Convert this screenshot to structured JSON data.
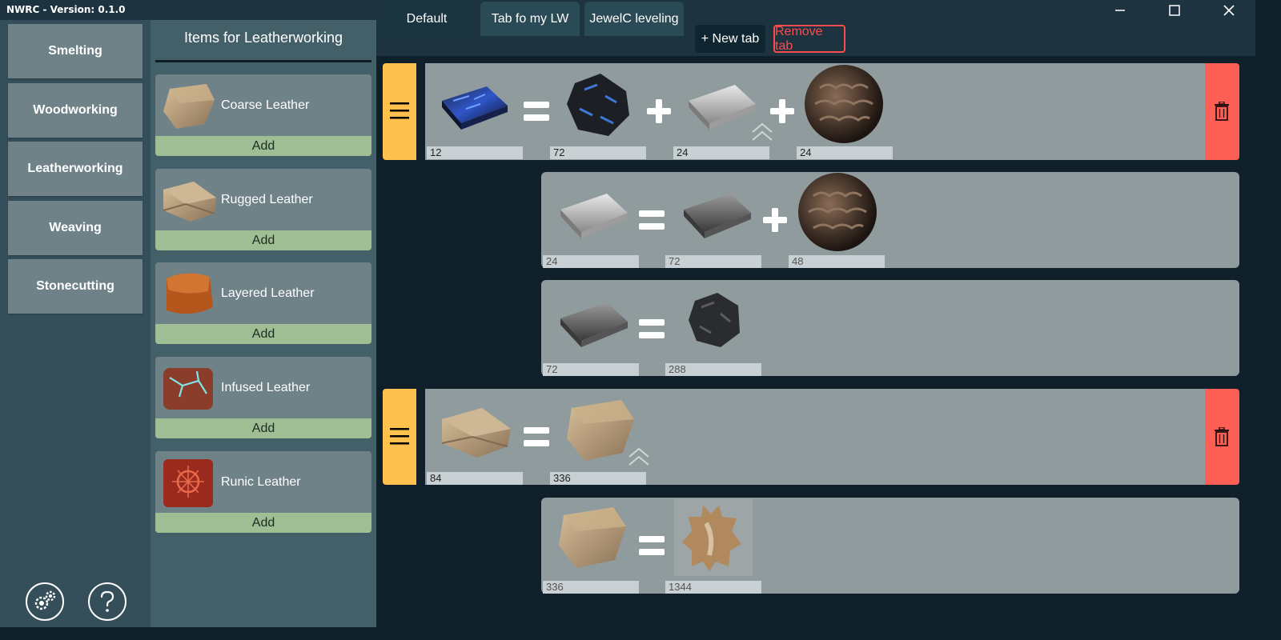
{
  "window": {
    "title": "NWRC - Version: 0.1.0"
  },
  "nav": {
    "items": [
      "Smelting",
      "Woodworking",
      "Leatherworking",
      "Weaving",
      "Stonecutting"
    ],
    "settings_icon": "gears-icon",
    "help_icon": "question-icon"
  },
  "items_panel": {
    "title": "Items for Leatherworking",
    "add_label": "Add",
    "items": [
      {
        "name": "Coarse Leather",
        "icon": "coarse-leather-icon"
      },
      {
        "name": "Rugged Leather",
        "icon": "rugged-leather-icon"
      },
      {
        "name": "Layered Leather",
        "icon": "layered-leather-icon"
      },
      {
        "name": "Infused Leather",
        "icon": "infused-leather-icon"
      },
      {
        "name": "Runic Leather",
        "icon": "runic-leather-icon"
      }
    ]
  },
  "tabs": {
    "items": [
      "Default",
      "Tab fo my LW",
      "JewelC leveling"
    ],
    "new_tab": "+ New tab",
    "remove_tab": "Remove tab"
  },
  "recipes": {
    "r1": {
      "output": "12",
      "in1": "72",
      "in2": "24",
      "in3": "24"
    },
    "r1a": {
      "output": "24",
      "in1": "72",
      "in2": "48"
    },
    "r1b": {
      "output": "72",
      "in1": "288"
    },
    "r2": {
      "output": "84",
      "in1": "336"
    },
    "r2a": {
      "output": "336",
      "in1": "1344"
    }
  },
  "colors": {
    "handle": "#fec14d",
    "delete": "#fe5f55",
    "add": "#9fbe94",
    "remove_tab": "#ff4b4b"
  }
}
